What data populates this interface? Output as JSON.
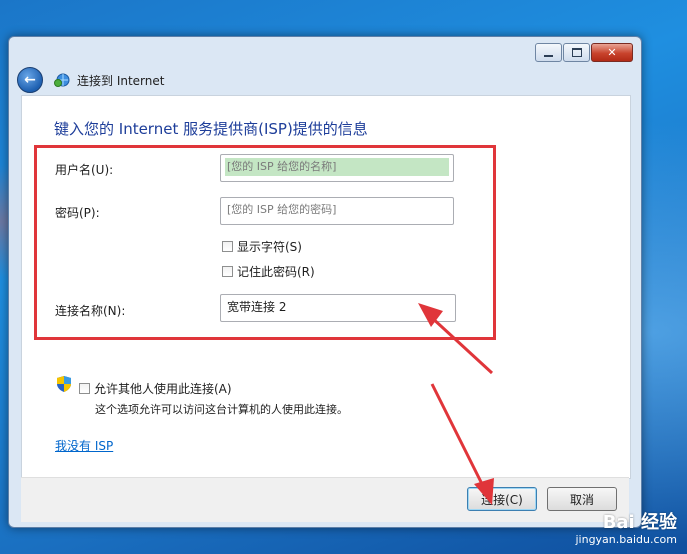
{
  "dialog": {
    "nav_title": "连接到 Internet",
    "heading": "键入您的 Internet 服务提供商(ISP)提供的信息"
  },
  "form": {
    "username_label": "用户名(U):",
    "username_placeholder": "[您的 ISP 给您的名称]",
    "password_label": "密码(P):",
    "password_placeholder": "[您的 ISP 给您的密码]",
    "show_chars_label": "显示字符(S)",
    "show_chars_checked": false,
    "remember_label": "记住此密码(R)",
    "remember_checked": false,
    "connection_name_label": "连接名称(N):",
    "connection_name_value": "宽带连接 2",
    "allow_others_label": "允许其他人使用此连接(A)",
    "allow_others_checked": false,
    "allow_others_desc": "这个选项允许可以访问这台计算机的人使用此连接。",
    "no_isp_link": "我没有 ISP"
  },
  "buttons": {
    "connect": "连接(C)",
    "cancel": "取消"
  },
  "watermark": {
    "main": "Bai 经验",
    "sub": "jingyan.baidu.com"
  },
  "colors": {
    "heading": "#1e3e9a",
    "link": "#0066cc",
    "annotation": "#e0353a",
    "focus_field": "#c4e6c4"
  },
  "icons": [
    "back-arrow-icon",
    "network-icon",
    "uac-shield-icon",
    "minimize-icon",
    "maximize-icon",
    "close-icon"
  ]
}
